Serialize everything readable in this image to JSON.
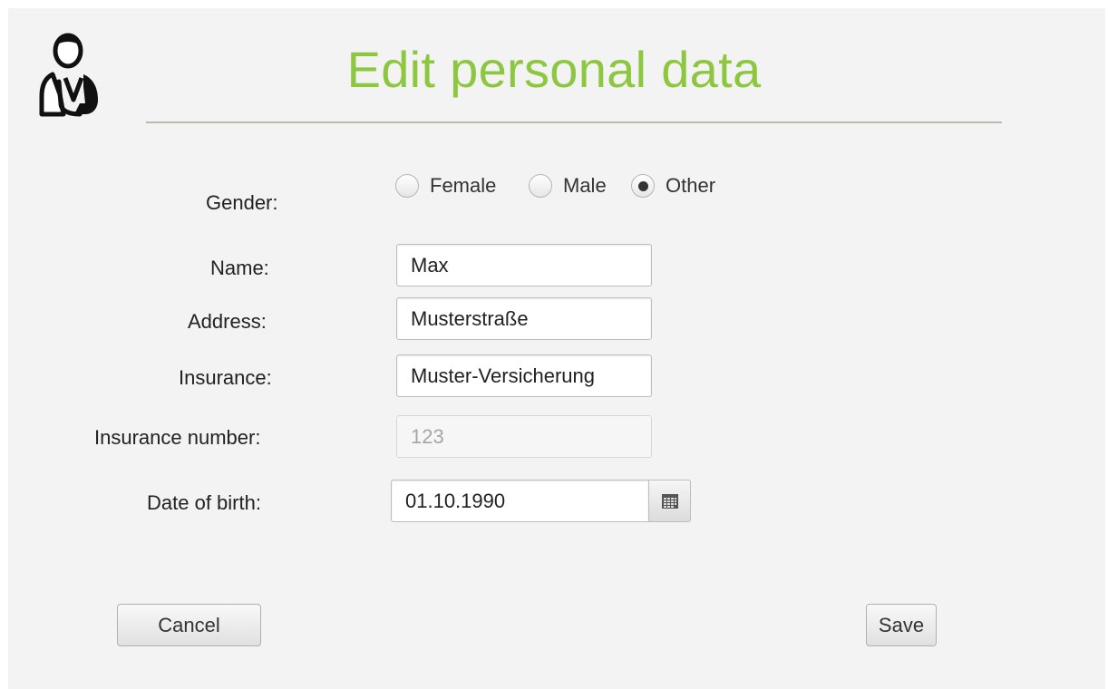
{
  "header": {
    "title": "Edit personal data",
    "avatar_icon": "doctor-user-icon",
    "title_color": "#8dc63f"
  },
  "form": {
    "gender": {
      "label": "Gender:",
      "options": [
        {
          "label": "Female",
          "checked": false
        },
        {
          "label": "Male",
          "checked": false
        },
        {
          "label": "Other",
          "checked": true
        }
      ]
    },
    "name": {
      "label": "Name:",
      "value": "Max"
    },
    "address": {
      "label": "Address:",
      "value": "Musterstraße"
    },
    "insurance": {
      "label": "Insurance:",
      "value": "Muster-Versicherung"
    },
    "insurance_number": {
      "label": "Insurance number:",
      "value": "123",
      "disabled": true
    },
    "date_of_birth": {
      "label": "Date of birth:",
      "value": "01.10.1990",
      "picker_icon": "calendar-icon"
    }
  },
  "actions": {
    "cancel_label": "Cancel",
    "save_label": "Save"
  }
}
